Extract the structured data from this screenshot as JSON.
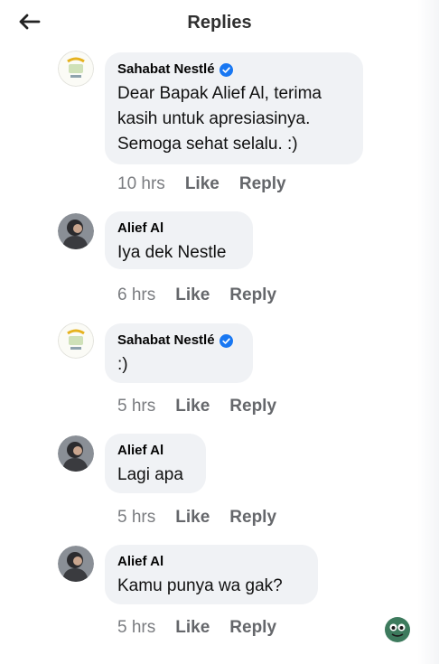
{
  "header": {
    "title": "Replies"
  },
  "comments": [
    {
      "author": "Sahabat Nestlé",
      "verified": true,
      "text": "Dear Bapak Alief Al, terima\nkasih untuk apresiasinya.\nSemoga sehat selalu. :)",
      "time": "10 hrs",
      "like": "Like",
      "reply": "Reply"
    },
    {
      "author": "Alief Al",
      "verified": false,
      "text": "Iya dek Nestle",
      "time": "6 hrs",
      "like": "Like",
      "reply": "Reply"
    },
    {
      "author": "Sahabat Nestlé",
      "verified": true,
      "text": ":)",
      "time": "5 hrs",
      "like": "Like",
      "reply": "Reply"
    },
    {
      "author": "Alief Al",
      "verified": false,
      "text": "Lagi apa",
      "time": "5 hrs",
      "like": "Like",
      "reply": "Reply"
    },
    {
      "author": "Alief Al",
      "verified": false,
      "text": "Kamu punya wa gak?",
      "time": "5 hrs",
      "like": "Like",
      "reply": "Reply"
    }
  ],
  "icons": {
    "back": "back-arrow-icon",
    "verified": "verified-badge-icon",
    "floating": "floating-emoji-icon"
  },
  "colors": {
    "bubble": "#f0f2f5",
    "meta_text": "#65676b",
    "verified_blue": "#1877f2"
  }
}
